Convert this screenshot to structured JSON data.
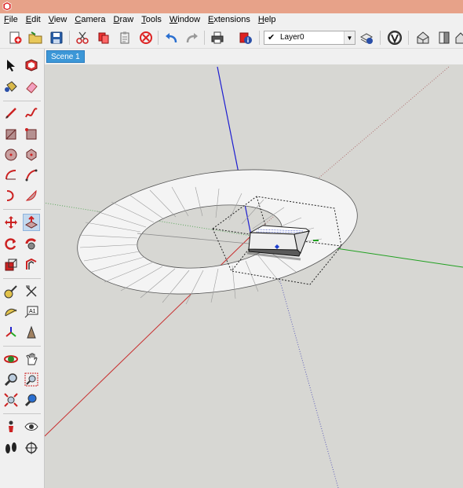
{
  "menu": [
    {
      "mnemonic": "F",
      "rest": "ile"
    },
    {
      "mnemonic": "E",
      "rest": "dit"
    },
    {
      "mnemonic": "V",
      "rest": "iew"
    },
    {
      "mnemonic": "C",
      "rest": "amera"
    },
    {
      "mnemonic": "D",
      "rest": "raw"
    },
    {
      "mnemonic": "T",
      "rest": "ools"
    },
    {
      "mnemonic": "W",
      "rest": "indow"
    },
    {
      "mnemonic": "E",
      "rest": "xtensions"
    },
    {
      "mnemonic": "H",
      "rest": "elp"
    }
  ],
  "layer": {
    "current": "Layer0"
  },
  "scene_tab": "Scene 1",
  "colors": {
    "accent": "#3c97d7",
    "titlebar": "#e7a289",
    "viewport_bg": "#d7d7d3",
    "axis_red": "#c83232",
    "axis_green": "#20a020",
    "axis_blue": "#1c1cd0"
  }
}
